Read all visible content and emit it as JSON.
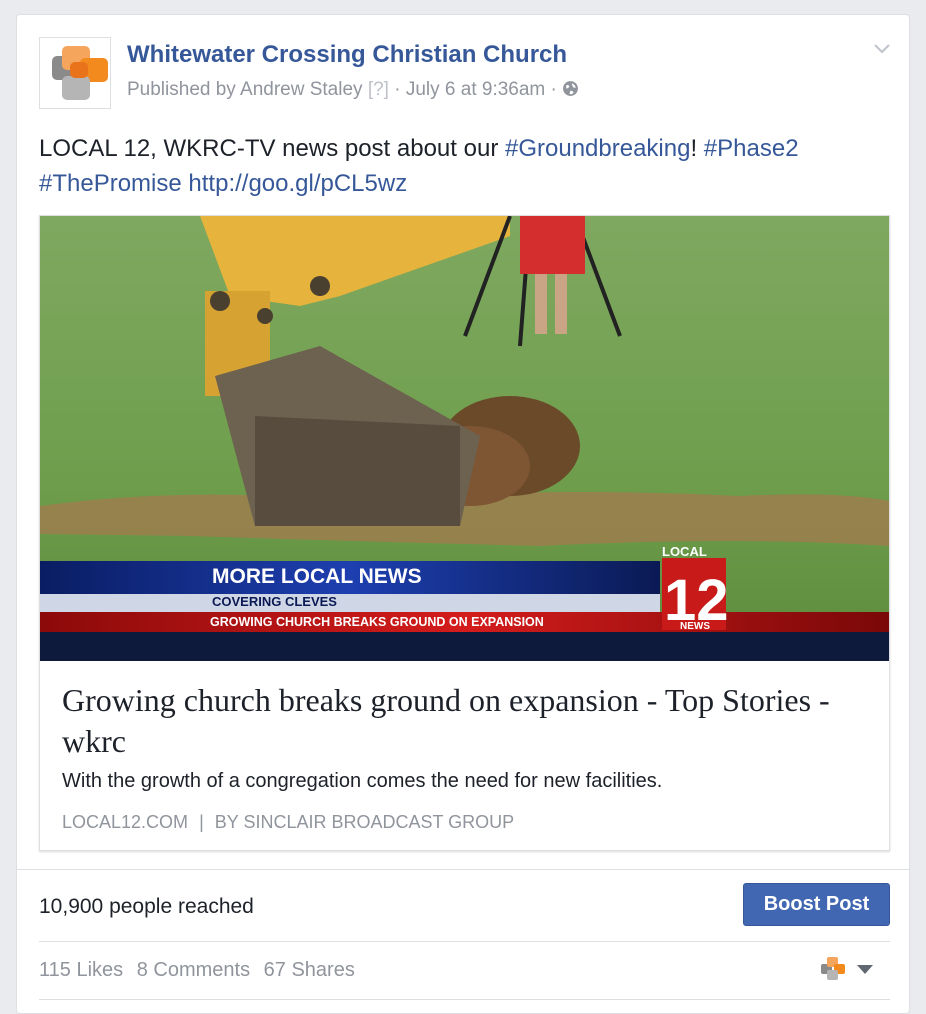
{
  "post": {
    "page_name": "Whitewater Crossing Christian Church",
    "published_by": "Published by Andrew Staley",
    "help_marker": "[?]",
    "date_time": "July 6 at 9:36am",
    "sep": "·",
    "privacy_icon": "globe-icon",
    "text_prefix": "LOCAL 12, WKRC-TV news post about our ",
    "hashtag_1": "#Groundbreaking",
    "text_bang": "!",
    "hashtag_2": "#Phase2",
    "hashtag_3": "#ThePromise",
    "link_url": "http://goo.gl/pCL5wz"
  },
  "link_preview": {
    "ticker_headline": "MORE LOCAL NEWS",
    "ticker_sub": "COVERING CLEVES",
    "ticker_story": "GROWING CHURCH BREAKS GROUND ON EXPANSION",
    "station_top": "LOCAL",
    "station_number": "12",
    "station_bottom": "NEWS",
    "title": "Growing church breaks ground on expansion - Top Stories - wkrc",
    "description": "With the growth of a congregation comes the need for new facilities.",
    "source": "LOCAL12.COM",
    "source_sep": "|",
    "source_by": "BY SINCLAIR BROADCAST GROUP"
  },
  "insights": {
    "reach": "10,900 people reached",
    "boost_label": "Boost Post"
  },
  "engagement": {
    "likes": "115 Likes",
    "comments": "8 Comments",
    "shares": "67 Shares"
  },
  "colors": {
    "link_blue": "#365899",
    "boost_blue": "#4267b2",
    "logo_orange": "#f28a1e",
    "logo_gray": "#8a8a8a"
  }
}
